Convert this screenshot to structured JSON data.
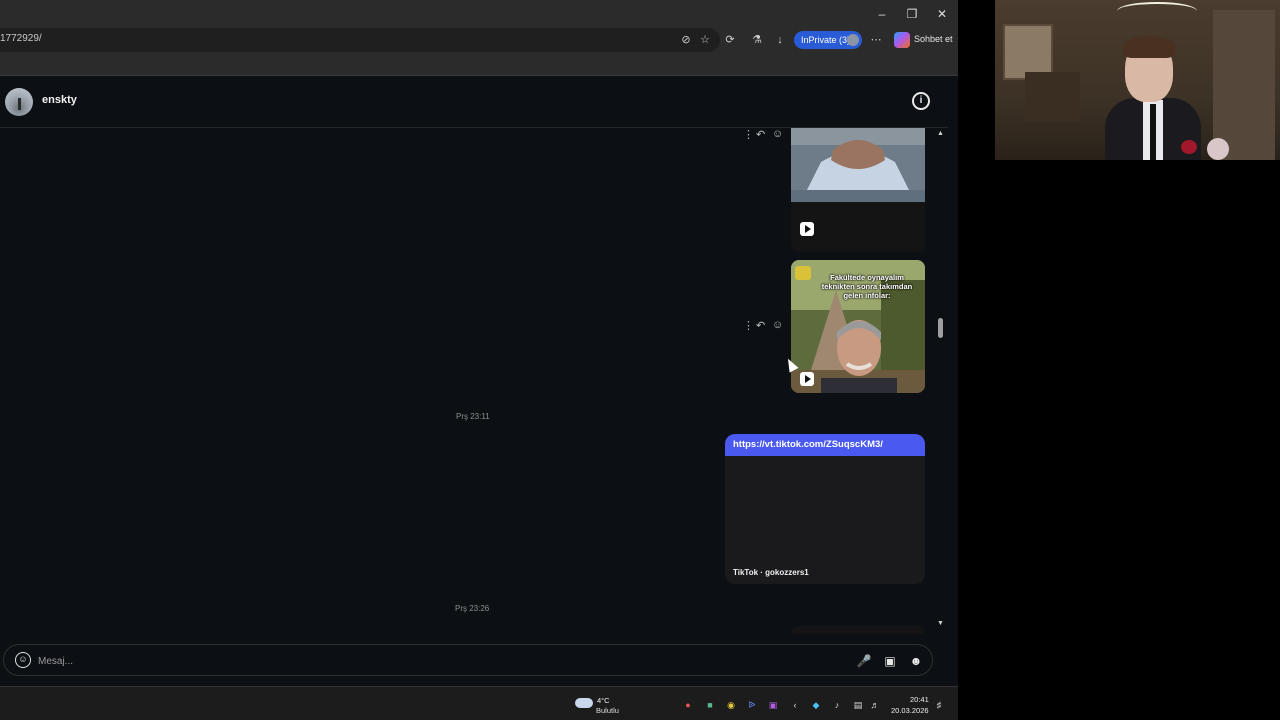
{
  "browser": {
    "url": "1772929/",
    "inprivate_label": "InPrivate (3)",
    "copilot_label": "Sohbet et",
    "icons": [
      "tracking-prevention-icon",
      "favorite-star-icon",
      "extensions-icon",
      "browser-essentials-icon",
      "downloads-icon",
      "more-icon",
      "minimize-icon",
      "restore-icon",
      "close-icon"
    ]
  },
  "chat": {
    "username": "enskty",
    "messages": [
      {
        "type": "video",
        "icons": [
          "more-icon",
          "reply-icon",
          "react-icon"
        ]
      },
      {
        "type": "video",
        "overlay_text": "Fakültede oynayalım\nteknikten sonra takımdan\ngelen infolar:"
      },
      {
        "type": "timestamp",
        "text": "Prş 23:11"
      },
      {
        "type": "link",
        "url": "https://vt.tiktok.com/ZSuqscKM3/",
        "source": "TikTok · gokozzers1"
      },
      {
        "type": "timestamp",
        "text": "Prş 23:26"
      }
    ],
    "composer": {
      "placeholder": "Mesaj...",
      "icons": [
        "emoji-icon",
        "microphone-icon",
        "image-icon",
        "sticker-icon"
      ]
    }
  },
  "taskbar": {
    "weather_temp": "4°C",
    "weather_condition": "Bulutlu",
    "time": "20:41",
    "date": "20.03.2026"
  }
}
